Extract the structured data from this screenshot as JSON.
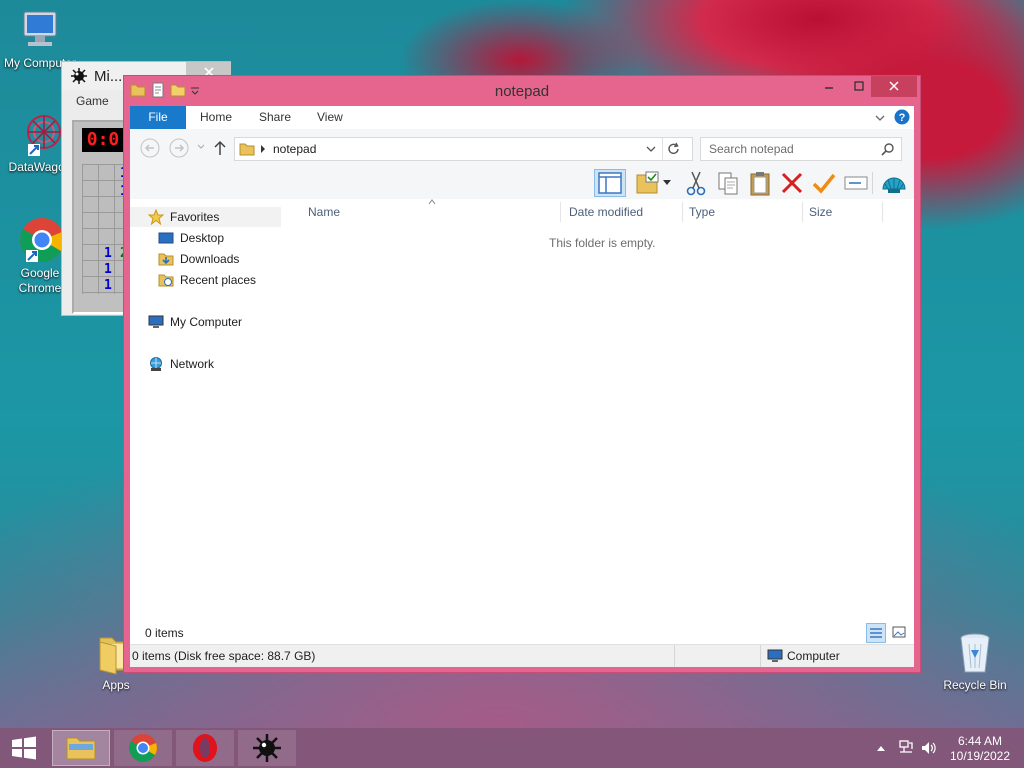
{
  "desktop": {
    "icons": [
      {
        "label": "My Computer"
      },
      {
        "label": "DataWagon"
      },
      {
        "label": "Google Chrome"
      },
      {
        "label": "Apps"
      },
      {
        "label": "Recycle Bin"
      }
    ]
  },
  "minesweeper": {
    "title": "Mi...",
    "menu": "Game",
    "counter": "0:0",
    "numbers": [
      "1",
      "1",
      "1",
      "2",
      "1",
      "1"
    ]
  },
  "explorer": {
    "title": "notepad",
    "ribbon_tabs": [
      "File",
      "Home",
      "Share",
      "View"
    ],
    "address_path": "notepad",
    "search_placeholder": "Search notepad",
    "nav": {
      "favorites": "Favorites",
      "desktop": "Desktop",
      "downloads": "Downloads",
      "recent": "Recent places",
      "computer": "My Computer",
      "network": "Network"
    },
    "columns": [
      "Name",
      "Date modified",
      "Type",
      "Size"
    ],
    "empty_message": "This folder is empty.",
    "item_count": "0 items",
    "status_left": "0 items (Disk free space: 88.7 GB)",
    "status_right": "Computer"
  },
  "taskbar": {
    "apps": [
      "File Explorer",
      "Google Chrome",
      "Opera",
      "Minesweeper"
    ],
    "time": "6:44 AM",
    "date": "10/19/2022"
  }
}
